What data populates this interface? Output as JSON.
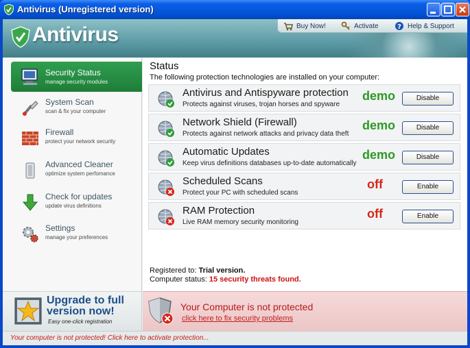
{
  "window": {
    "title": "Antivirus (Unregistered version)"
  },
  "header": {
    "logo_text": "Antivirus",
    "nav": [
      {
        "label": "Buy Now!",
        "icon": "cart-icon"
      },
      {
        "label": "Activate",
        "icon": "key-icon"
      },
      {
        "label": "Help & Support",
        "icon": "help-icon"
      }
    ]
  },
  "sidebar": {
    "items": [
      {
        "label": "Security Status",
        "sub": "manage security modules",
        "icon": "monitor-icon",
        "active": true
      },
      {
        "label": "System Scan",
        "sub": "scan & fix your computer",
        "icon": "scan-icon"
      },
      {
        "label": "Firewall",
        "sub": "protect your network security",
        "icon": "firewall-icon"
      },
      {
        "label": "Advanced Cleaner",
        "sub": "optimize system perfomance",
        "icon": "cleaner-icon"
      },
      {
        "label": "Check for updates",
        "sub": "update virus definitions",
        "icon": "download-arrow-icon"
      },
      {
        "label": "Settings",
        "sub": "manage your preferences",
        "icon": "settings-icon"
      }
    ]
  },
  "main": {
    "title": "Status",
    "subtitle": "The following protection technologies are installed on your computer:",
    "protections": [
      {
        "name": "Antivirus and Antispyware protection",
        "desc": "Protects against viruses, trojan horses and spyware",
        "state": "demo",
        "button": "Disable",
        "ok": true
      },
      {
        "name": "Network Shield (Firewall)",
        "desc": "Protects against network attacks and privacy data theft",
        "state": "demo",
        "button": "Disable",
        "ok": true
      },
      {
        "name": "Automatic Updates",
        "desc": "Keep virus definitions databases up-to-date automatically",
        "state": "demo",
        "button": "Disable",
        "ok": true
      },
      {
        "name": "Scheduled Scans",
        "desc": "Protect your PC with scheduled scans",
        "state": "off",
        "button": "Enable",
        "ok": false
      },
      {
        "name": "RAM Protection",
        "desc": "Live RAM memory security monitoring",
        "state": "off",
        "button": "Enable",
        "ok": false
      }
    ],
    "registered_label": "Registered to:",
    "registered_value": "Trial version.",
    "computer_status_label": "Computer status:",
    "computer_status_value": "15 security threats found."
  },
  "upgrade": {
    "title": "Upgrade to full version now!",
    "sub": "Easy one-click registration"
  },
  "warning": {
    "title": "Your Computer is not protected",
    "link": "click here to fix security problems"
  },
  "statusbar": {
    "text": "Your computer is not protected! Click here to activate protection..."
  },
  "colors": {
    "accent_green": "#2c9a24",
    "alert_red": "#d3271a",
    "title_blue": "#0353d6"
  }
}
